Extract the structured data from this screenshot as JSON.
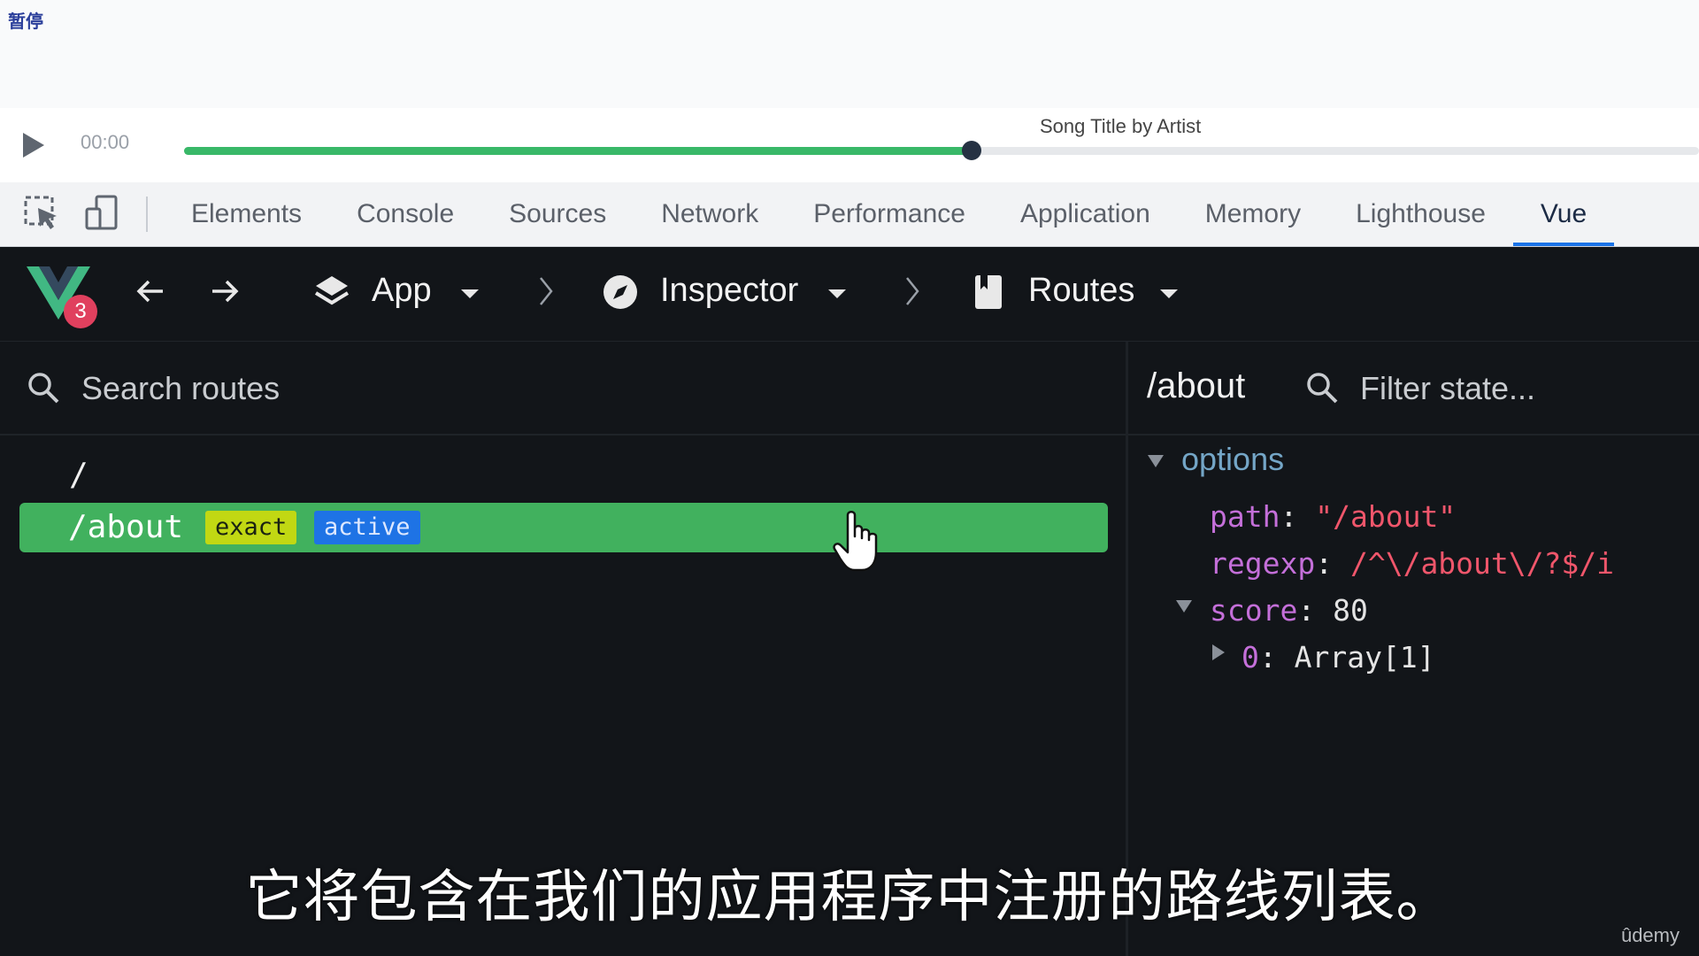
{
  "overlay": {
    "pause_label": "暂停"
  },
  "player": {
    "time": "00:00",
    "song_title": "Song Title by Artist",
    "progress": 0.52
  },
  "devtools": {
    "tabs": [
      "Elements",
      "Console",
      "Sources",
      "Network",
      "Performance",
      "Application",
      "Memory",
      "Lighthouse",
      "Vue"
    ],
    "active_tab": "Vue"
  },
  "vue_toolbar": {
    "version_badge": "3",
    "app_label": "App",
    "inspector_label": "Inspector",
    "routes_label": "Routes"
  },
  "routes_pane": {
    "search_placeholder": "Search routes",
    "routes": [
      {
        "path": "/"
      },
      {
        "path": "/about",
        "tags": [
          "exact",
          "active"
        ]
      }
    ]
  },
  "state_pane": {
    "title": "/about",
    "filter_placeholder": "Filter state...",
    "section": "options",
    "path_key": "path",
    "path_value": "\"/about\"",
    "regexp_key": "regexp",
    "regexp_value": "/^\\/about\\/?$/i",
    "score_key": "score",
    "score_value": "80",
    "array_key": "0",
    "array_value": "Array[1]"
  },
  "subtitle": "它将包含在我们的应用程序中注册的路线列表。",
  "watermark": "ûdemy",
  "colors": {
    "vue_green": "#41b15e",
    "tab_active": "#1a73e8",
    "badge": "#e0405e"
  }
}
